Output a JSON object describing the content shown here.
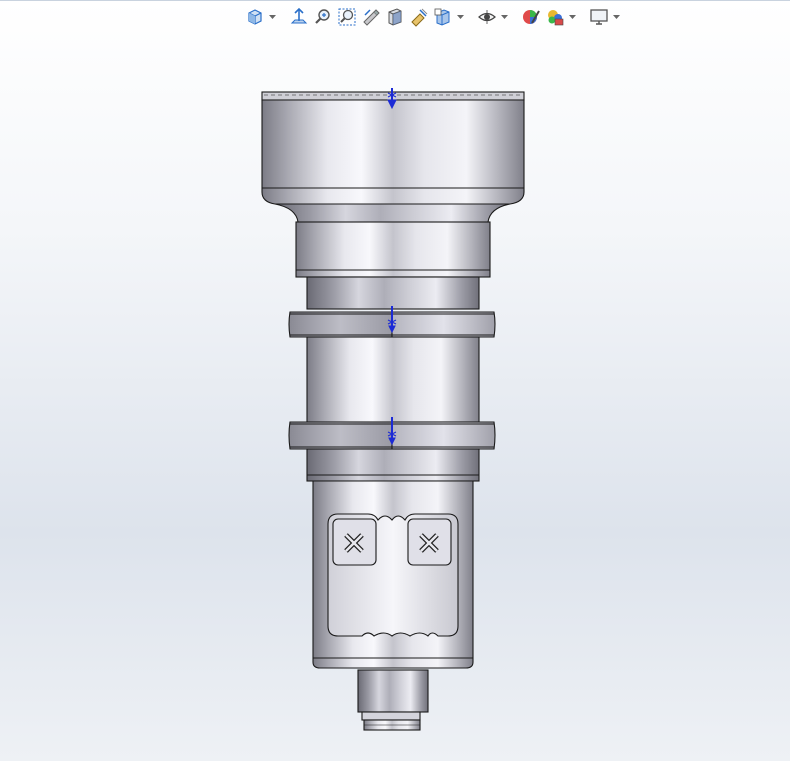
{
  "toolbar": {
    "items": [
      {
        "name": "view-orientation",
        "icon": "view-cube-icon",
        "dropdown": true
      },
      {
        "name": "normal-to",
        "icon": "normal-to-icon",
        "dropdown": false
      },
      {
        "name": "zoom-to-fit",
        "icon": "zoom-to-fit-icon",
        "dropdown": false
      },
      {
        "name": "zoom-to-area",
        "icon": "zoom-to-area-icon",
        "dropdown": false
      },
      {
        "name": "previous-view",
        "icon": "previous-view-icon",
        "dropdown": false
      },
      {
        "name": "section-view",
        "icon": "section-view-icon",
        "dropdown": false
      },
      {
        "name": "dynamic-annotation-views",
        "icon": "dynamic-annotation-icon",
        "dropdown": false
      },
      {
        "name": "display-style",
        "icon": "display-style-icon",
        "dropdown": true
      },
      {
        "name": "hide-show-items",
        "icon": "eye-icon",
        "dropdown": true
      },
      {
        "name": "edit-appearance",
        "icon": "appearance-icon",
        "dropdown": false
      },
      {
        "name": "apply-scene",
        "icon": "scene-icon",
        "dropdown": true
      },
      {
        "name": "view-settings",
        "icon": "monitor-icon",
        "dropdown": true
      }
    ]
  },
  "colors": {
    "background_top": "#ffffff",
    "background_mid": "#dde3ec",
    "metal_light": "#f4f4f8",
    "metal_dark": "#8a8a94",
    "edge": "#1a1a1a",
    "origin_marker": "#1c2bd6",
    "toolbar_blue": "#2a6fc9"
  }
}
